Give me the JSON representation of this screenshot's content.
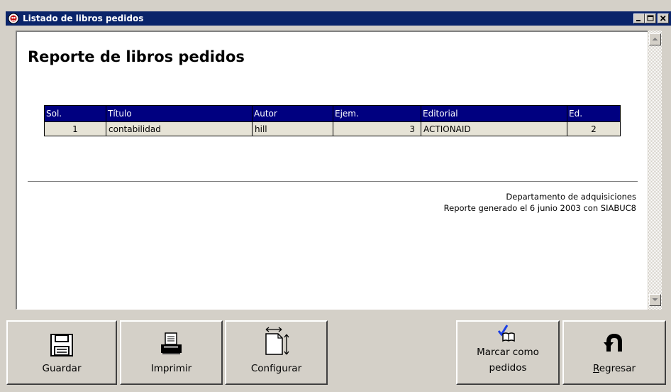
{
  "window": {
    "title": "Listado de libros pedidos"
  },
  "report": {
    "title": "Reporte de libros pedidos",
    "columns": [
      "Sol.",
      "Título",
      "Autor",
      "Ejem.",
      "Editorial",
      "Ed."
    ],
    "rows": [
      [
        "1",
        "contabilidad",
        "hill",
        "3",
        "ACTIONAID",
        "2"
      ]
    ],
    "footer": {
      "line1": "Departamento de adquisiciones",
      "line2": "Reporte generado el 6 junio 2003 con SIABUC8"
    }
  },
  "buttons": {
    "guardar": {
      "label": "Guardar",
      "icon": "floppy-disk-icon"
    },
    "imprimir": {
      "label": "Imprimir",
      "icon": "printer-icon"
    },
    "configurar": {
      "label": "Configurar",
      "icon": "page-setup-icon"
    },
    "marcar": {
      "label_line1": "Marcar como",
      "label_line2": "pedidos",
      "icon": "checked-book-icon"
    },
    "regresar": {
      "label_first": "R",
      "label_rest": "egresar",
      "icon": "u-turn-arrow-icon"
    }
  },
  "colors": {
    "titlebar": "#0a246a",
    "table_header": "#000080",
    "table_row": "#e6e3d6",
    "check": "#1a3ee6"
  }
}
